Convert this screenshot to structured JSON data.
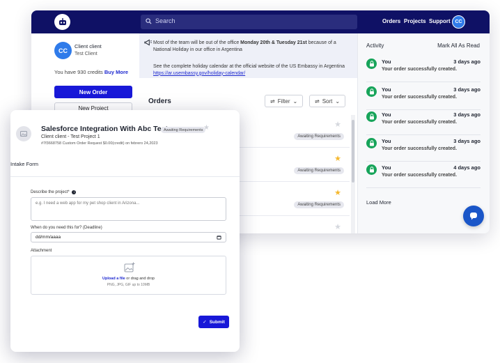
{
  "topbar": {
    "search_placeholder": "Search",
    "nav": [
      "Orders",
      "Projects",
      "Support"
    ],
    "avatar_initials": "CC"
  },
  "user": {
    "initials": "CC",
    "name": "Client client",
    "subtitle": "Test Client",
    "credits_text": "You have 930 credits",
    "buy_more": "Buy More"
  },
  "sidebar": {
    "new_order": "New Order",
    "new_project": "New Project"
  },
  "notice": {
    "part1": "Most of the team will be out of the office ",
    "bold": "Monday 20th & Tuesday 21st",
    "part2": " because of a National Holiday in our office in Argentina",
    "line2": "See the complete holiday calendar at the official website of the US Embassy in Argentina",
    "link": "https://ar.usembassy.gov/holiday-calendar/"
  },
  "orders": {
    "title": "Orders",
    "filter": "Filter",
    "sort": "Sort",
    "rows": [
      {
        "badge": "Awaiting Requirements"
      },
      {
        "badge": "Awaiting Requirements"
      },
      {
        "badge": "Awaiting Requirements"
      },
      {
        "badge": ""
      }
    ]
  },
  "activity": {
    "title": "Activity",
    "mark_all": "Mark All As Read",
    "items": [
      {
        "who": "You",
        "when": "3 days ago",
        "msg": "Your order successfully created."
      },
      {
        "who": "You",
        "when": "3 days ago",
        "msg": "Your order successfully created."
      },
      {
        "who": "You",
        "when": "3 days ago",
        "msg": "Your order successfully created."
      },
      {
        "who": "You",
        "when": "3 days ago",
        "msg": "Your order successfully created."
      },
      {
        "who": "You",
        "when": "4 days ago",
        "msg": "Your order successfully created."
      }
    ],
    "load_more": "Load More"
  },
  "modal": {
    "title": "Salesforce Integration With Abc Test",
    "badge": "Awaiting Requirements",
    "subtitle": "Client client - Test Project 1",
    "meta": "#7f3668758   Custom Order Request   $0.00(credit) on febrero 24,2023",
    "tab": "Intake Form",
    "desc_label": "Describe the project*",
    "desc_placeholder": "e.g. I need a web app for my pet shop client in Arizona...",
    "deadline_label": "When do you need this for? (Deadline)",
    "deadline_value": "dd/mm/aaaa",
    "attachment_label": "Attachment",
    "upload_link": "Upload a file",
    "upload_rest": " or drag and drop",
    "upload_hint": "PNG, JPG, GIF up to 10MB",
    "submit": "Submit"
  },
  "colors": {
    "navy": "#0f1165",
    "primary": "#1818d8",
    "success": "#17a45a",
    "star_gold": "#f5b82e"
  }
}
